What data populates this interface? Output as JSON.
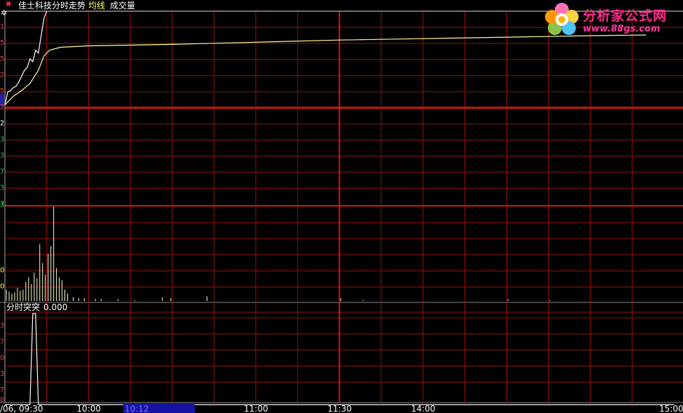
{
  "header": {
    "close_glyph": "✖",
    "title": "佳士科技分时走势",
    "avg_line_label": "均线",
    "volume_label": "成交量"
  },
  "indicator_panel": {
    "label": "分时突突",
    "value": "0.000"
  },
  "time_axis": {
    "ticks": [
      {
        "label": "/06, 09:30",
        "t": 0
      },
      {
        "label": "10:00",
        "t": 30
      },
      {
        "label": "11:00",
        "t": 90
      },
      {
        "label": "11:30",
        "t": 120
      },
      {
        "label": "14:00",
        "t": 150
      },
      {
        "label": "15:00",
        "t": 240
      }
    ],
    "cursor_label": "10:12",
    "cursor_t": 42
  },
  "left_ticks": {
    "price": [
      {
        "text": "1",
        "color": "#ff3b3b"
      },
      {
        "text": "5",
        "color": "#ff3b3b"
      },
      {
        "text": "5",
        "color": "#ff3b3b"
      },
      {
        "text": "2",
        "color": "#ff3b3b"
      },
      {
        "text": "5",
        "color": "#ff3b3b"
      },
      {
        "text": "2",
        "color": "#ff3b3b"
      },
      {
        "text": "2",
        "color": "#ffffff"
      },
      {
        "text": "3",
        "color": "#2ecc40"
      },
      {
        "text": "3",
        "color": "#2ecc40"
      },
      {
        "text": "7",
        "color": "#2ecc40"
      },
      {
        "text": "3",
        "color": "#2ecc40"
      },
      {
        "text": "7",
        "color": "#2ecc40"
      },
      {
        "text": "3",
        "color": "#2ecc40"
      }
    ],
    "volume": [
      {
        "text": "0",
        "color": "#ffff66"
      },
      {
        "text": "0",
        "color": "#ffff66"
      }
    ],
    "indicator": [
      {
        "text": "3",
        "color": "#ff3b3b"
      },
      {
        "text": "7",
        "color": "#ff3b3b"
      },
      {
        "text": "0",
        "color": "#ff3b3b"
      },
      {
        "text": "3",
        "color": "#ff3b3b"
      },
      {
        "text": "7",
        "color": "#ff3b3b"
      },
      {
        "text": "0",
        "color": "#ff3b3b"
      }
    ]
  },
  "logo": {
    "title": "分析家公式网",
    "url": "www.88gs.com"
  },
  "colors": {
    "grid": "#9b0f0f",
    "grid_bold": "#d01818",
    "price_line": "#ffffff",
    "avg_line": "#ffff99",
    "volume_bar": "#ffffcc",
    "indicator_line": "#ffffff",
    "cursor_bg": "#1414a0",
    "cursor_text": "#6666ff",
    "header_text": "#ffffff",
    "avg_label": "#ffff66",
    "volume_label": "#ffffff",
    "axis_text": "#ffffff"
  },
  "chart_data": [
    {
      "type": "line",
      "series": [
        {
          "name": "分时走势",
          "x": [
            0,
            1,
            2,
            3,
            4,
            5,
            6,
            7,
            8,
            9,
            10,
            11,
            12,
            13,
            14,
            15
          ],
          "y": [
            0.0,
            0.9,
            1.0,
            1.2,
            1.3,
            1.6,
            2.0,
            2.4,
            2.6,
            3.2,
            3.0,
            3.8,
            3.6,
            4.8,
            6.0,
            6.5
          ]
        },
        {
          "name": "均线",
          "x": [
            0,
            3,
            6,
            9,
            12,
            14,
            16,
            20,
            30,
            60,
            90,
            120,
            150,
            180,
            210,
            230
          ],
          "y": [
            0.0,
            0.6,
            1.0,
            1.5,
            2.4,
            3.4,
            3.8,
            4.0,
            4.1,
            4.2,
            4.35,
            4.5,
            4.6,
            4.7,
            4.8,
            4.85
          ]
        }
      ],
      "ylim": [
        0,
        6.5
      ],
      "xlim": [
        0,
        240
      ]
    },
    {
      "type": "bar",
      "x": [
        0,
        1,
        2,
        3,
        4,
        5,
        6,
        7,
        8,
        9,
        10,
        11,
        12,
        13,
        14,
        15,
        16,
        17,
        18,
        19,
        20,
        21,
        22,
        24,
        26,
        28,
        32,
        34,
        40,
        46,
        56,
        59,
        72,
        120,
        128,
        180,
        195
      ],
      "values": [
        12,
        10,
        8,
        9,
        14,
        11,
        12,
        20,
        25,
        18,
        30,
        24,
        60,
        40,
        28,
        50,
        58,
        100,
        35,
        25,
        22,
        12,
        8,
        4,
        3,
        3,
        2,
        2,
        2,
        1,
        4,
        3,
        5,
        3,
        1,
        2,
        1
      ],
      "ylim": [
        0,
        100
      ]
    },
    {
      "type": "line",
      "x": [
        0,
        8,
        9,
        10,
        11,
        12,
        13,
        240
      ],
      "values": [
        0,
        0,
        0,
        1,
        1,
        0,
        0,
        0
      ],
      "ylim": [
        0,
        1
      ]
    }
  ]
}
